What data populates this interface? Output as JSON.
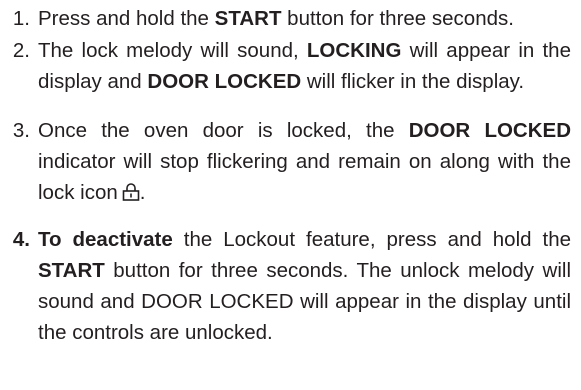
{
  "steps": [
    {
      "number": "1.",
      "parts": [
        "Press and hold the ",
        "START",
        " button for three seconds."
      ]
    },
    {
      "number": "2.",
      "parts": [
        "The lock melody will sound, ",
        "LOCKING",
        " will appear in the display and ",
        "DOOR LOCKED",
        " will flicker in the display."
      ]
    },
    {
      "number": "3.",
      "parts": [
        "Once the oven door is locked, the ",
        "DOOR LOCKED",
        " indicator will stop flickering and remain on along with the lock icon",
        "."
      ]
    },
    {
      "number": "4.",
      "parts": [
        "To deactivate",
        " the Lockout feature, press and hold the ",
        "START",
        " button for three seconds. The unlock melody will sound and DOOR LOCKED will appear in the display until the controls are unlocked."
      ]
    }
  ],
  "icons": {
    "lock": "lock-icon"
  }
}
